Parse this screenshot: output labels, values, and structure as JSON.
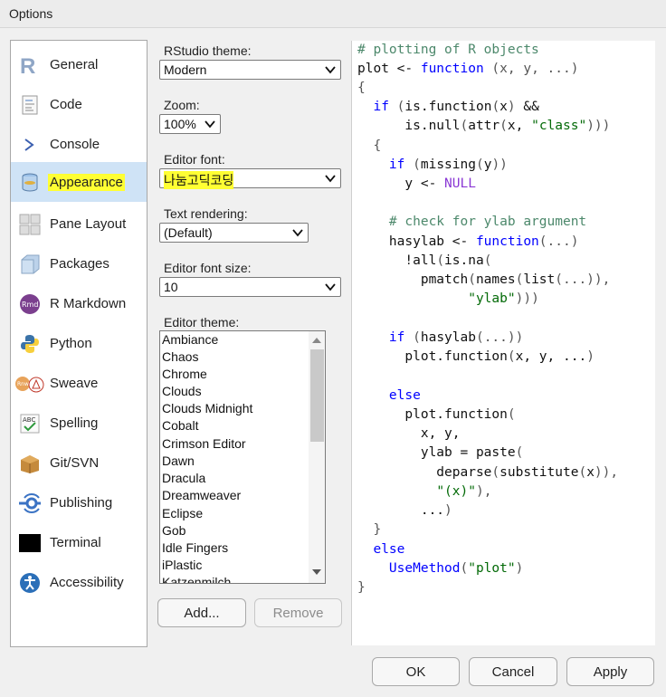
{
  "window": {
    "title": "Options"
  },
  "sidebar": {
    "items": [
      {
        "label": "General",
        "icon": "r-logo-icon",
        "selected": false
      },
      {
        "label": "Code",
        "icon": "code-document-icon",
        "selected": false
      },
      {
        "label": "Console",
        "icon": "console-prompt-icon",
        "selected": false
      },
      {
        "label": "Appearance",
        "icon": "appearance-bucket-icon",
        "selected": true
      },
      {
        "label": "Pane Layout",
        "icon": "pane-layout-icon",
        "selected": false
      },
      {
        "label": "Packages",
        "icon": "packages-box-icon",
        "selected": false
      },
      {
        "label": "R Markdown",
        "icon": "rmarkdown-icon",
        "selected": false
      },
      {
        "label": "Python",
        "icon": "python-logo-icon",
        "selected": false
      },
      {
        "label": "Sweave",
        "icon": "sweave-pdf-icon",
        "selected": false
      },
      {
        "label": "Spelling",
        "icon": "spelling-check-icon",
        "selected": false
      },
      {
        "label": "Git/SVN",
        "icon": "git-box-icon",
        "selected": false
      },
      {
        "label": "Publishing",
        "icon": "publishing-icon",
        "selected": false
      },
      {
        "label": "Terminal",
        "icon": "terminal-icon",
        "selected": false
      },
      {
        "label": "Accessibility",
        "icon": "accessibility-icon",
        "selected": false
      }
    ]
  },
  "appearance": {
    "rstudio_theme_label": "RStudio theme:",
    "rstudio_theme_value": "Modern",
    "zoom_label": "Zoom:",
    "zoom_value": "100%",
    "editor_font_label": "Editor font:",
    "editor_font_value": "나눔고딕코딩",
    "text_rendering_label": "Text rendering:",
    "text_rendering_value": "(Default)",
    "editor_font_size_label": "Editor font size:",
    "editor_font_size_value": "10",
    "editor_theme_label": "Editor theme:",
    "editor_themes": [
      "Ambiance",
      "Chaos",
      "Chrome",
      "Clouds",
      "Clouds Midnight",
      "Cobalt",
      "Crimson Editor",
      "Dawn",
      "Dracula",
      "Dreamweaver",
      "Eclipse",
      "Gob",
      "Idle Fingers",
      "iPlastic",
      "Katzenmilch"
    ],
    "add_button": "Add...",
    "remove_button": "Remove"
  },
  "preview": {
    "lines": [
      "# plotting of R objects",
      "plot <- function (x, y, ...)",
      "{",
      "  if (is.function(x) &&",
      "      is.null(attr(x, \"class\")))",
      "  {",
      "    if (missing(y))",
      "      y <- NULL",
      "",
      "    # check for ylab argument",
      "    hasylab <- function(...)",
      "      !all(is.na(",
      "        pmatch(names(list(...)),",
      "              \"ylab\")))",
      "",
      "    if (hasylab(...))",
      "      plot.function(x, y, ...)",
      "",
      "    else",
      "      plot.function(",
      "        x, y,",
      "        ylab = paste(",
      "          deparse(substitute(x)),",
      "          \"(x)\"),",
      "        ...)",
      "  }",
      "  else",
      "    UseMethod(\"plot\")",
      "}"
    ]
  },
  "footer": {
    "ok": "OK",
    "cancel": "Cancel",
    "apply": "Apply"
  },
  "colors": {
    "selection": "#cfe3f6",
    "highlight": "#ffff33",
    "keyword": "#0000ff",
    "comment": "#4c886b",
    "string": "#036a07"
  }
}
